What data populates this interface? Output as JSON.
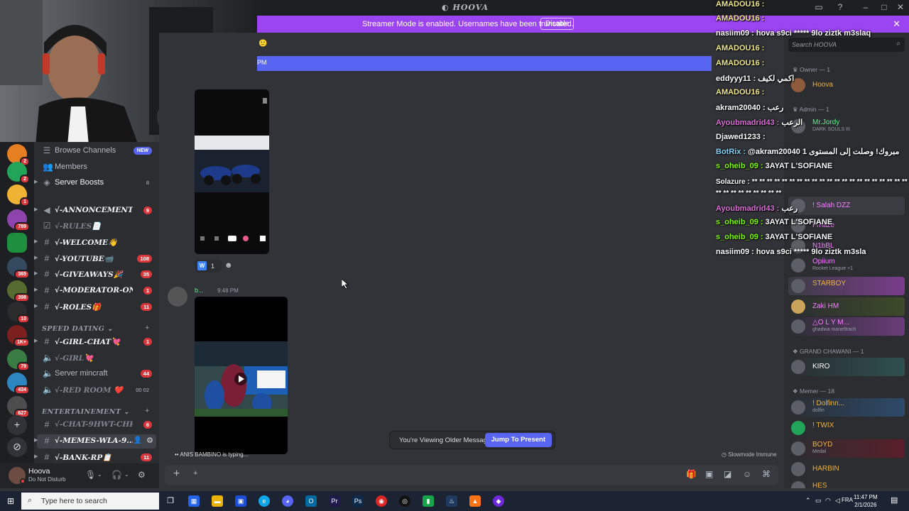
{
  "window": {
    "title": "HOOVA"
  },
  "banner": {
    "text": "Streamer Mode is enabled. Usernames have been truncated.",
    "disable_label": "Disable"
  },
  "server_badges": [
    "2",
    "2",
    "1",
    "789",
    "",
    "365",
    "398",
    "10",
    "1K+",
    "79",
    "434",
    "627"
  ],
  "channels": [
    {
      "label": "Browse Channels",
      "style": "plain",
      "badge": "NEW",
      "badge_type": "new"
    },
    {
      "label": "Members",
      "style": "plain",
      "badge": ""
    },
    {
      "label": "Server Boosts",
      "style": "plain-bright",
      "badge": "8",
      "badge_type": "grey"
    },
    {
      "label": "√-ANNONCEMENTS...",
      "style": "fancy",
      "badge": "9"
    },
    {
      "label": "√-RULES📄",
      "style": "fancy-muted",
      "badge": ""
    },
    {
      "label": "√-WELCOME👋",
      "style": "fancy",
      "badge": ""
    },
    {
      "label": "√-YOUTUBE📹",
      "style": "fancy",
      "badge": "108"
    },
    {
      "label": "√-GIVEAWAYS🎉",
      "style": "fancy",
      "badge": "35"
    },
    {
      "label": "√-MODERATOR-ON...",
      "style": "fancy",
      "badge": "1"
    },
    {
      "label": "√-ROLES🎁",
      "style": "fancy",
      "badge": "11"
    },
    {
      "label": "√-GIRL-CHAT💘",
      "style": "fancy",
      "badge": "1"
    },
    {
      "label": "√-GIRL💘",
      "style": "fancy-muted",
      "badge": ""
    },
    {
      "label": "Server mincraft",
      "style": "plain",
      "badge": "44"
    },
    {
      "label": "√-RED ROOM ❤️",
      "style": "fancy-muted",
      "badge": "00 02",
      "badge_type": "grey"
    },
    {
      "label": "√-CHAT-9HWT-CHR...",
      "style": "fancy-muted",
      "badge": "6"
    },
    {
      "label": "√-MEMES-WLA-9...",
      "style": "fancy",
      "badge": ""
    },
    {
      "label": "√-BANK-RP📋",
      "style": "fancy",
      "badge": "11"
    }
  ],
  "categories": {
    "speed_dating": "SPEED DATING",
    "entertainement": "ENTERTAINEMENT"
  },
  "user": {
    "name": "Hoova",
    "status": "Do Not Disturb"
  },
  "chat": {
    "highlight_time": "PM",
    "reaction_count": "1",
    "author": "b...",
    "time": "9:48 PM",
    "older_text": "You're Viewing Older Messages",
    "jump_label": "Jump To Present",
    "typing": "ANIS BAMBINO is typing...",
    "slowmode": "Slowmode Immune"
  },
  "search": {
    "placeholder": "Search HOOVA"
  },
  "member_groups": [
    {
      "title": "Owner — 1"
    },
    {
      "title": "Admin — 1"
    },
    {
      "title": "GRAND CHAWANI — 1"
    },
    {
      "title": "Memer — 18"
    }
  ],
  "members": [
    {
      "name": "Hoova",
      "sub": "",
      "color": "#f0b232"
    },
    {
      "name": "Mr.Jordy",
      "sub": "DARK SOULS III",
      "color": "#57f287"
    },
    {
      "name": "! Salah DZZ",
      "sub": "",
      "color": "#f47fff"
    },
    {
      "name": "Frhaze",
      "sub": "",
      "color": "#f47fff"
    },
    {
      "name": "N1bBL",
      "sub": "",
      "color": "#f47fff"
    },
    {
      "name": "Opiium",
      "sub": "Rocket League +1",
      "color": "#f47fff"
    },
    {
      "name": "STARBOY",
      "sub": "",
      "color": "#f0b232"
    },
    {
      "name": "Zaki HM",
      "sub": "",
      "color": "#f47fff"
    },
    {
      "name": "△O L Y M...",
      "sub": "ghadwa mane9rach",
      "color": "#f47fff"
    },
    {
      "name": "KIRO",
      "sub": "",
      "color": "#ffffff"
    },
    {
      "name": "! Dolfinn...",
      "sub": "dolfin",
      "color": "#f0b232"
    },
    {
      "name": "! TWIX",
      "sub": "",
      "color": "#f0b232"
    },
    {
      "name": "BOYD",
      "sub": "Medal",
      "color": "#f0b232"
    },
    {
      "name": "HARBIN",
      "sub": "",
      "color": "#f0b232"
    },
    {
      "name": "HES",
      "sub": "",
      "color": "#f0b232"
    }
  ],
  "overlay_chat": [
    {
      "user": "AMADOU16 :",
      "msg": "",
      "color": "#f0e68c"
    },
    {
      "user": "AMADOU16 :",
      "msg": "",
      "color": "#f0e68c"
    },
    {
      "user": "nasiim09 :",
      "msg": "hova s9ci ***** 9lo ziztk m3slaq",
      "color": "#ffffff"
    },
    {
      "user": "AMADOU16 :",
      "msg": "",
      "color": "#f0e68c"
    },
    {
      "user": "AMADOU16 :",
      "msg": "",
      "color": "#f0e68c"
    },
    {
      "user": "eddyyy11 :",
      "msg": "اكمي لكيف",
      "color": "#ffffff"
    },
    {
      "user": "AMADOU16 :",
      "msg": "",
      "color": "#f0e68c"
    },
    {
      "user": "akram20040 :",
      "msg": "رعب",
      "color": "#ffffff"
    },
    {
      "user": "Ayoubmadrid43 :",
      "msg": "الرعب",
      "color": "#da70d6"
    },
    {
      "user": "Djawed1233 :",
      "msg": "",
      "color": "#ffffff"
    },
    {
      "user": "BotRix :",
      "msg": "@akram20040 مبروك! وصلت إلى المستوى 1",
      "color": "#7dd3fc"
    },
    {
      "user": "s_oheib_09 :",
      "msg": "3AYAT L'SOFIANE",
      "color": "#7cfc00"
    },
    {
      "user": "Solazure :",
      "msg": "** ** ** ** ** ** ** ** ** ** ** ** ** ** ** ** ** ** ** ** ** ** ** ** ** ** ** ** ** **",
      "color": "#ffffff"
    },
    {
      "user": "Ayoubmadrid43 :",
      "msg": "رعب",
      "color": "#da70d6"
    },
    {
      "user": "s_oheib_09 :",
      "msg": "3AYAT L'SOFIANE",
      "color": "#7cfc00"
    },
    {
      "user": "s_oheib_09 :",
      "msg": "3AYAT L'SOFIANE",
      "color": "#7cfc00"
    },
    {
      "user": "nasiim09 :",
      "msg": "hova s9ci ***** 9lo ziztk m3sla",
      "color": "#ffffff"
    }
  ],
  "taskbar": {
    "search_placeholder": "Type here to search",
    "lang": "FRA",
    "time": "11:47 PM",
    "date": "2/1/2026"
  }
}
